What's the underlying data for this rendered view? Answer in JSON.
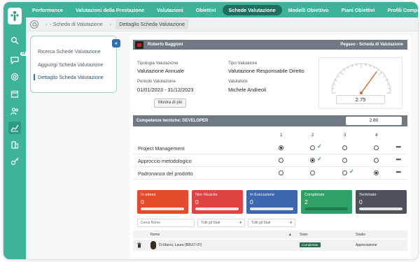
{
  "nav": {
    "items": [
      {
        "label": "Performance",
        "active": false
      },
      {
        "label": "Valutazioni della Prestazione",
        "active": false
      },
      {
        "label": "Valutazioni",
        "active": false
      },
      {
        "label": "Obiettivi",
        "active": false
      },
      {
        "label": "Schede Valutazione",
        "active": true
      },
      {
        "label": "Modelli Obiettivo",
        "active": false
      },
      {
        "label": "Piani Obiettivi",
        "active": false
      },
      {
        "label": "Profili Competenze",
        "active": false
      }
    ]
  },
  "rail": {
    "icons": [
      "search-icon",
      "chat-icon",
      "target-icon",
      "calendar-icon",
      "people-icon",
      "chart-icon",
      "building-icon",
      "key-icon"
    ],
    "badge": "20",
    "active_icon": "chart-icon"
  },
  "breadcrumb": {
    "parent": "- Scheda di Valutazione",
    "current": "Dettaglio Scheda Valutazione"
  },
  "side_menu": {
    "items": [
      {
        "label": "Ricerca Schede Valutazione",
        "active": false
      },
      {
        "label": "Aggiungi Scheda Valutazione",
        "active": false
      },
      {
        "label": "Dettaglio Scheda Valutazione",
        "active": true
      }
    ],
    "collapse_glyph": "«"
  },
  "header": {
    "user_name": "Roberto Baggioni",
    "module_title": "Pegaso - Scheda di Valutazione"
  },
  "details": {
    "tipologia_label": "Tipologia Valutazione",
    "tipologia_value": "Valutazione Annuale",
    "tipo_label": "Tipo Valutatore",
    "tipo_value": "Valutazione Responsabile Diretto",
    "periodo_label": "Periodo Valutazione",
    "periodo_value": "01/01/2023 - 31/12/2023",
    "valutatore_label": "Valutatore",
    "valutatore_value": "Michele Andreoli",
    "more_label": "Mostra di più"
  },
  "gauge": {
    "score": "2.75",
    "value_fraction": 0.7
  },
  "competency": {
    "title": "Competenze tecniche: DEVELOPER",
    "score": "2.80",
    "columns": [
      "1",
      "2",
      "3",
      "4"
    ],
    "rows": [
      {
        "label": "Project Management",
        "selected": 1,
        "check": 2
      },
      {
        "label": "Approccio metodologico",
        "selected": 2,
        "check": 2
      },
      {
        "label": "Padronanza del prodotto",
        "selected": 4,
        "check": 3
      }
    ],
    "more_glyph": "•••"
  },
  "status_tiles": [
    {
      "label": "In attesa",
      "count": "0",
      "color": "#e34b2b",
      "fill": 0
    },
    {
      "label": "Non Riuscite",
      "count": "0",
      "color": "#e04343",
      "fill": 0
    },
    {
      "label": "In Esecuzione",
      "count": "0",
      "color": "#3f67ad",
      "fill": 0
    },
    {
      "label": "Completate",
      "count": "2",
      "color": "#2fa168",
      "fill": 1
    },
    {
      "label": "Terminate",
      "count": "0",
      "color": "#4e5359",
      "fill": 0
    }
  ],
  "filters": {
    "search_placeholder": "Cerca Nome",
    "stati_1": "Tutti gli Stati",
    "stati_2": "Tutti gli Stati"
  },
  "table": {
    "headers": [
      "Nome",
      "Stato",
      "Stadio"
    ],
    "rows": [
      {
        "name": "Di Marco, Laura (89517-07)",
        "stato": "Completato",
        "stadio": "Approvazione"
      }
    ]
  }
}
